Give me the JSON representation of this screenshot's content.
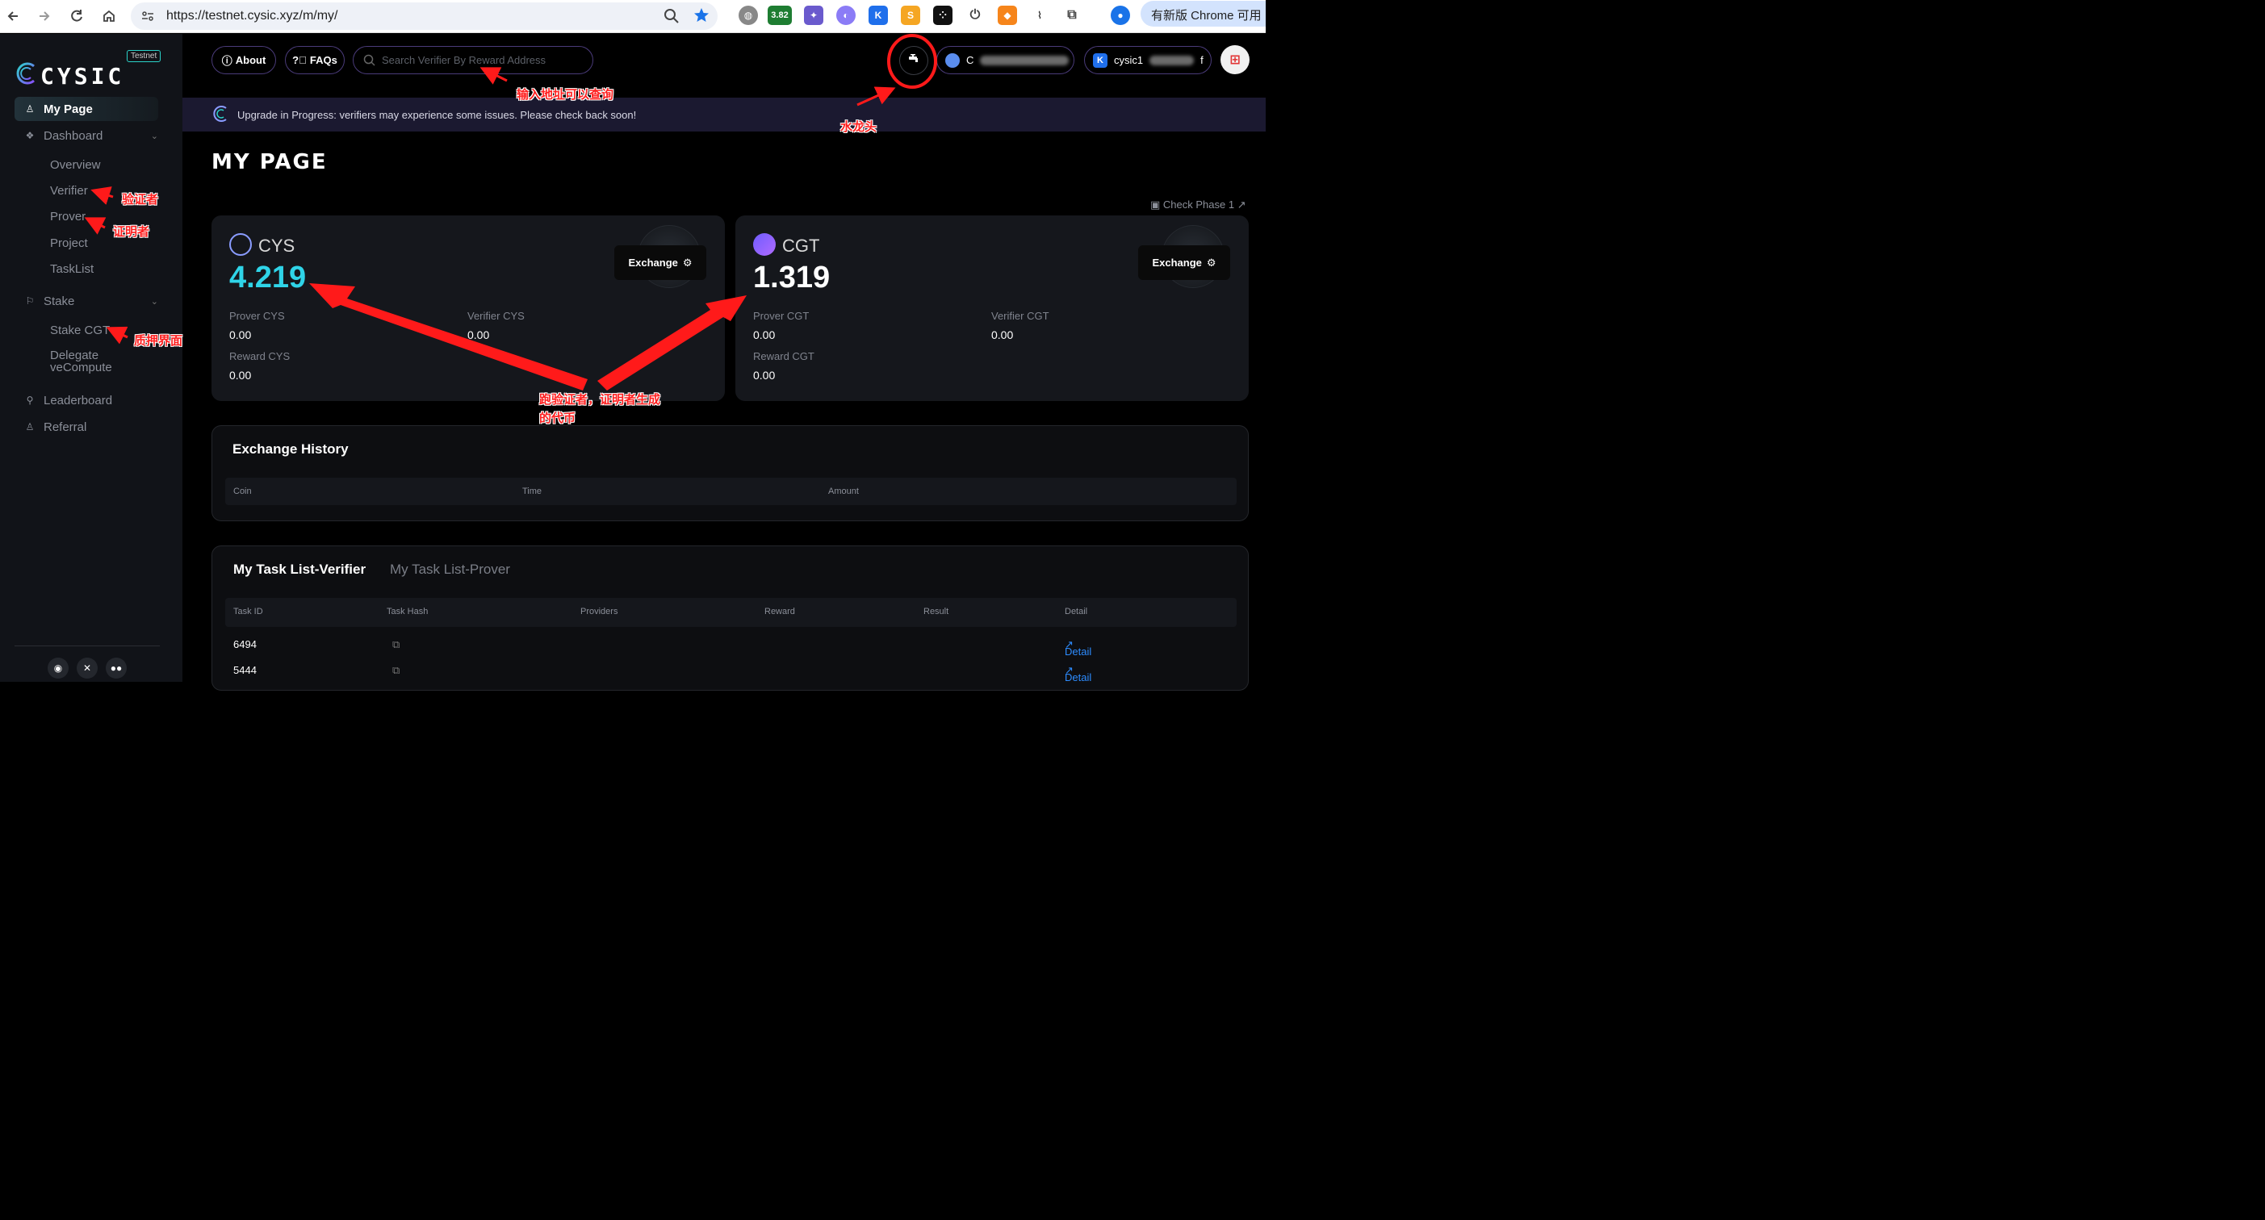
{
  "browser": {
    "url": "https://testnet.cysic.xyz/m/my/",
    "extension_badge": "3.82",
    "update_button": "有新版 Chrome 可用"
  },
  "sidebar": {
    "logo": "CYSIC",
    "badge": "Testnet",
    "items": [
      {
        "label": "My Page",
        "icon": "user-icon",
        "active": true
      },
      {
        "label": "Dashboard",
        "icon": "dashboard-icon"
      },
      {
        "label": "Stake",
        "icon": "flag-icon"
      },
      {
        "label": "Leaderboard",
        "icon": "trophy-icon"
      },
      {
        "label": "Referral",
        "icon": "referral-icon"
      }
    ],
    "dashboard_sub": [
      "Overview",
      "Verifier",
      "Prover",
      "Project",
      "TaskList"
    ],
    "stake_sub": [
      "Stake CGT",
      "Delegate veCompute"
    ],
    "social": [
      "discord-icon",
      "x-icon",
      "medium-icon"
    ]
  },
  "header": {
    "about": "About",
    "faqs": "FAQs",
    "search_placeholder": "Search Verifier By Reward Address",
    "wallet1_prefix": "C",
    "wallet2_prefix": "cysic1",
    "wallet2_suffix": "f"
  },
  "banner": {
    "text": "Upgrade in Progress: verifiers may experience some issues. Please check back soon!"
  },
  "page": {
    "title": "MY PAGE",
    "check_phase": "Check Phase 1"
  },
  "cards": [
    {
      "token": "CYS",
      "value": "4.219",
      "value_color": "#2fd4e8",
      "exchange": "Exchange",
      "prover_label": "Prover CYS",
      "prover_value": "0.00",
      "verifier_label": "Verifier CYS",
      "verifier_value": "0.00",
      "reward_label": "Reward CYS",
      "reward_value": "0.00"
    },
    {
      "token": "CGT",
      "value": "1.319",
      "value_color": "#ffffff",
      "exchange": "Exchange",
      "prover_label": "Prover CGT",
      "prover_value": "0.00",
      "verifier_label": "Verifier CGT",
      "verifier_value": "0.00",
      "reward_label": "Reward CGT",
      "reward_value": "0.00"
    }
  ],
  "exchange_history": {
    "title": "Exchange History",
    "columns": [
      "Coin",
      "Time",
      "Amount"
    ]
  },
  "tasks": {
    "tab_active": "My Task List-Verifier",
    "tab_inactive": "My Task List-Prover",
    "columns": [
      "Task ID",
      "Task Hash",
      "Providers",
      "Reward",
      "Result",
      "Detail"
    ],
    "rows": [
      {
        "id": "6494",
        "detail": "Detail"
      },
      {
        "id": "5444",
        "detail": "Detail"
      }
    ]
  },
  "annotations": {
    "search": "输入地址可以查询",
    "faucet": "水龙头",
    "verifier": "验证者",
    "prover": "证明者",
    "stake": "质押界面",
    "tokens_line1": "跑验证者，证明者生成",
    "tokens_line2": "的代币"
  },
  "colors": {
    "accent_cyan": "#2fd4e8",
    "border_purple": "#4a3b7a",
    "annotation_red": "#ff2020",
    "link_blue": "#2d8cff"
  }
}
